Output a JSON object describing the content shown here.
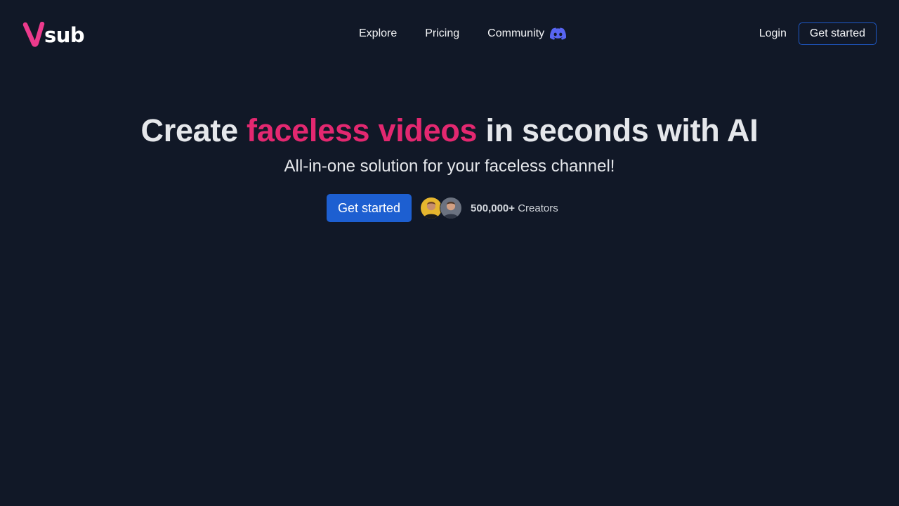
{
  "brand": {
    "logo_text": "sub",
    "accent_color": "#ec3a8c"
  },
  "nav": {
    "explore": "Explore",
    "pricing": "Pricing",
    "community": "Community",
    "community_icon": "discord-icon"
  },
  "auth": {
    "login": "Login",
    "get_started": "Get started"
  },
  "hero": {
    "headline_before": "Create",
    "headline_accent": "faceless videos",
    "headline_after": "in seconds with AI",
    "subheadline": "All-in-one solution for your faceless channel!",
    "cta_label": "Get started",
    "creators_count": "500,000+",
    "creators_label": "Creators"
  },
  "colors": {
    "background": "#111827",
    "accent": "#e32870",
    "primary_button": "#1d5fd1",
    "discord": "#5865f2"
  }
}
